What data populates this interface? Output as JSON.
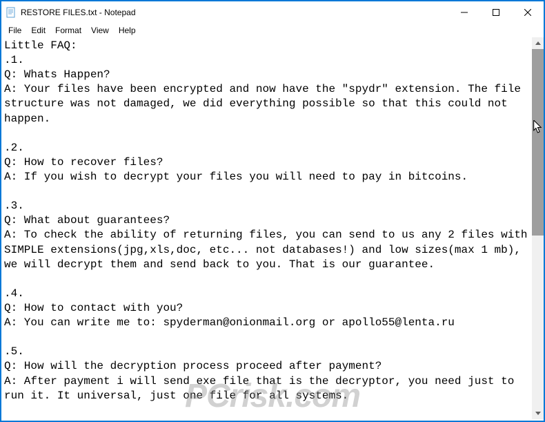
{
  "window": {
    "title": "RESTORE FILES.txt - Notepad"
  },
  "menu": {
    "file": "File",
    "edit": "Edit",
    "format": "Format",
    "view": "View",
    "help": "Help"
  },
  "content": {
    "text": "Little FAQ:\n.1.\nQ: Whats Happen?\nA: Your files have been encrypted and now have the \"spydr\" extension. The file structure was not damaged, we did everything possible so that this could not happen.\n\n.2.\nQ: How to recover files?\nA: If you wish to decrypt your files you will need to pay in bitcoins.\n\n.3.\nQ: What about guarantees?\nA: To check the ability of returning files, you can send to us any 2 files with SIMPLE extensions(jpg,xls,doc, etc... not databases!) and low sizes(max 1 mb), we will decrypt them and send back to you. That is our guarantee.\n\n.4.\nQ: How to contact with you?\nA: You can write me to: spyderman@onionmail.org or apollo55@lenta.ru\n\n.5.\nQ: How will the decryption process proceed after payment?\nA: After payment i will send exe file that is the decryptor, you need just to run it. It universal, just one file for all systems."
  },
  "watermark": "PCrisk.com"
}
